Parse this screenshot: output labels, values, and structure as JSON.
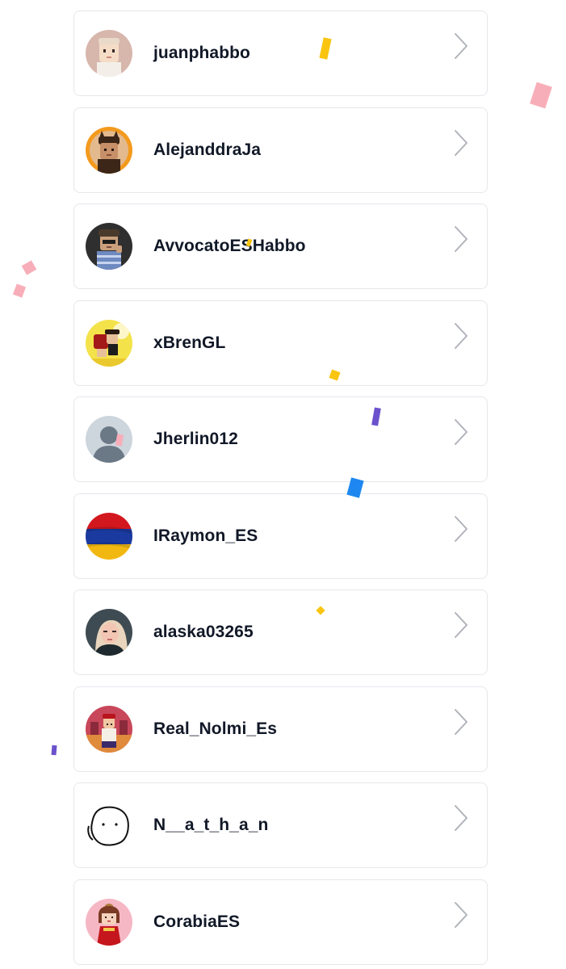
{
  "users": [
    {
      "username": "juanphabbo",
      "avatar_icon": "habbo-avatar-icon"
    },
    {
      "username": "AlejanddraJa",
      "avatar_icon": "habbo-avatar-icon"
    },
    {
      "username": "AvvocatoESHabbo",
      "avatar_icon": "habbo-avatar-icon"
    },
    {
      "username": "xBrenGL",
      "avatar_icon": "habbo-avatar-icon"
    },
    {
      "username": "Jherlin012",
      "avatar_icon": "default-user-icon"
    },
    {
      "username": "IRaymon_ES",
      "avatar_icon": "flag-avatar-icon"
    },
    {
      "username": "alaska03265",
      "avatar_icon": "photo-avatar-icon"
    },
    {
      "username": "Real_Nolmi_Es",
      "avatar_icon": "habbo-avatar-icon"
    },
    {
      "username": "N__a_t_h_a_n",
      "avatar_icon": "face-drawing-icon"
    },
    {
      "username": "CorabiaES",
      "avatar_icon": "habbo-avatar-icon"
    }
  ],
  "colors": {
    "card_border": "#e5e7eb",
    "username_text": "#111827",
    "chevron": "#b0b4ba",
    "confetti": [
      "#f9c511",
      "#f8aeb9",
      "#6b52cc",
      "#1e88f0"
    ]
  }
}
